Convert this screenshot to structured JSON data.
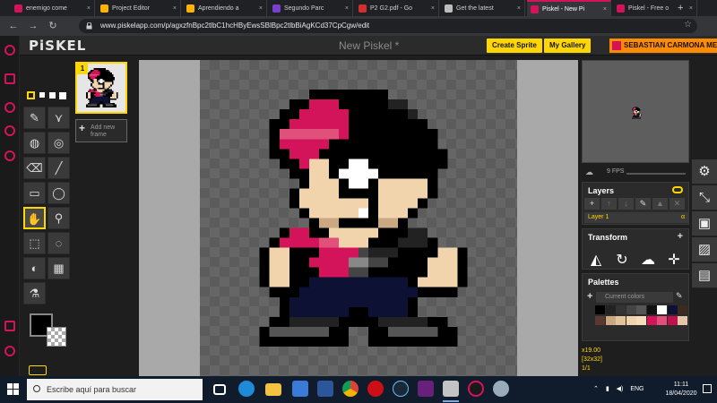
{
  "browser": {
    "tabs": [
      {
        "label": "enemigo come",
        "color": "#d4145a",
        "active": false
      },
      {
        "label": "Project Editor",
        "color": "#ffb300",
        "active": false
      },
      {
        "label": "Aprendiendo a",
        "color": "#ffb300",
        "active": false
      },
      {
        "label": "Segundo Parc",
        "color": "#7a3fd0",
        "active": false
      },
      {
        "label": "P2 G2.pdf - Go",
        "color": "#d32f2f",
        "active": false
      },
      {
        "label": "Get the latest",
        "color": "#bdbdbd",
        "active": false
      },
      {
        "label": "Piskel - New Pi",
        "color": "#d4145a",
        "active": true
      },
      {
        "label": "Piskel - Free o",
        "color": "#d4145a",
        "active": false
      }
    ],
    "url": "www.piskelapp.com/p/agxzfnBpc2tlbC1hcHByEwsSBlBpc2tlbBiAgKCd37CpCgw/edit"
  },
  "header": {
    "logo": "PiSKEL",
    "title": "New Piskel *",
    "create_sprite": "Create Sprite",
    "my_gallery": "My Gallery",
    "user": "SEBASTIAN CARMONA MEJIA"
  },
  "frames": {
    "frame_number": "1",
    "add_frame": "Add new frame"
  },
  "right_panel": {
    "fps": "9 FPS",
    "layers_title": "Layers",
    "layer_name": "Layer 1",
    "layer_alpha": "α",
    "transform_title": "Transform",
    "palettes_title": "Palettes",
    "palette_select": "Current colors",
    "zoom": "x19.00",
    "size": "[32x32]",
    "frame_index": "1/1"
  },
  "palette_colors": [
    "#000000",
    "#222222",
    "#333333",
    "#444444",
    "#555555",
    "#111111",
    "#ffffff",
    "#0d1133",
    "#3a2a20",
    "#5a3a30",
    "#c9a882",
    "#e2c49c",
    "#f1d4ac",
    "#f4ddb8",
    "#d4145a",
    "#e0507a",
    "#c0104e",
    "#e6c6a8"
  ],
  "taskbar": {
    "search_placeholder": "Escribe aquí para buscar",
    "lang": "ENG",
    "time": "11:11",
    "date": "18/04/2020"
  },
  "colors": {
    "accent": "#ffd700",
    "pink": "#d4145a",
    "skin": "#f1d4ac",
    "navy": "#0d1133"
  }
}
